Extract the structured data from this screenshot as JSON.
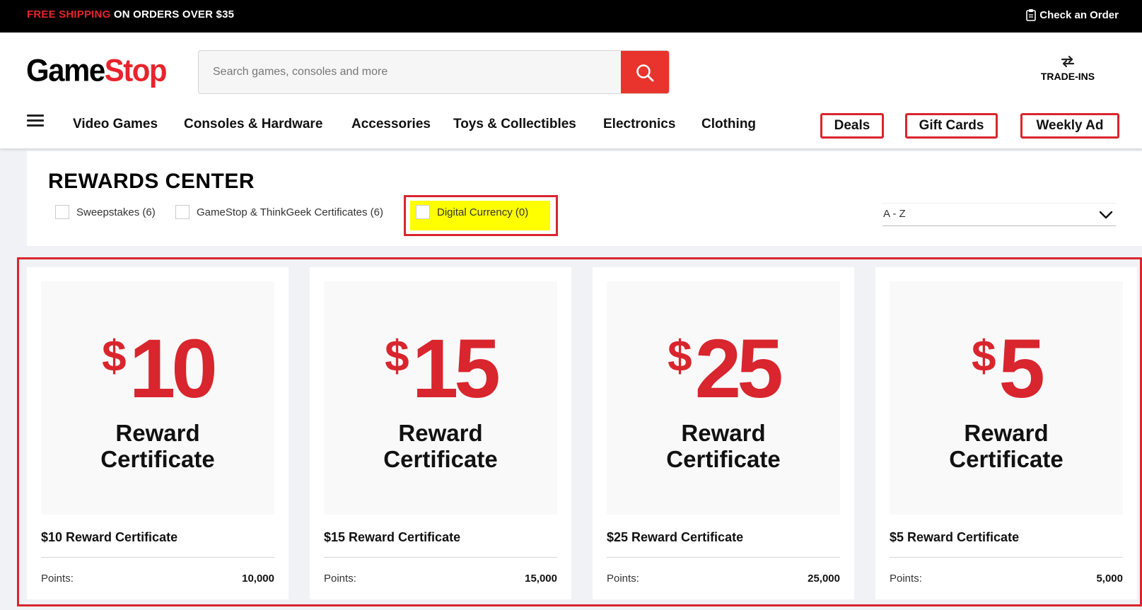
{
  "promo": {
    "free_shipping": "FREE SHIPPING",
    "on_orders": " ON ORDERS OVER $35",
    "check_order": "Check an Order"
  },
  "header": {
    "logo_game": "Game",
    "logo_stop": "Stop",
    "search_placeholder": "Search games, consoles and more",
    "trade_ins": "TRADE-INS"
  },
  "nav": {
    "items": [
      "Video Games",
      "Consoles & Hardware",
      "Accessories",
      "Toys & Collectibles",
      "Electronics",
      "Clothing"
    ],
    "deals": "Deals",
    "gift_cards": "Gift Cards",
    "weekly_ad": "Weekly Ad"
  },
  "rewards": {
    "title": "REWARDS CENTER",
    "filters": [
      "Sweepstakes (6)",
      "GameStop & ThinkGeek Certificates (6)",
      "Digital Currency (0)"
    ],
    "sort_value": "A - Z"
  },
  "products": [
    {
      "dollar": "$",
      "amount": "10",
      "line1": "Reward",
      "line2": "Certificate",
      "title": "$10 Reward Certificate",
      "points_label": "Points:",
      "points": "10,000"
    },
    {
      "dollar": "$",
      "amount": "15",
      "line1": "Reward",
      "line2": "Certificate",
      "title": "$15 Reward Certificate",
      "points_label": "Points:",
      "points": "15,000"
    },
    {
      "dollar": "$",
      "amount": "25",
      "line1": "Reward",
      "line2": "Certificate",
      "title": "$25 Reward Certificate",
      "points_label": "Points:",
      "points": "25,000"
    },
    {
      "dollar": "$",
      "amount": "5",
      "line1": "Reward",
      "line2": "Certificate",
      "title": "$5 Reward Certificate",
      "points_label": "Points:",
      "points": "5,000"
    }
  ],
  "colors": {
    "brand_red": "#e8242c",
    "highlight_yellow": "#ffff00",
    "annotation_red": "#d9252d"
  }
}
